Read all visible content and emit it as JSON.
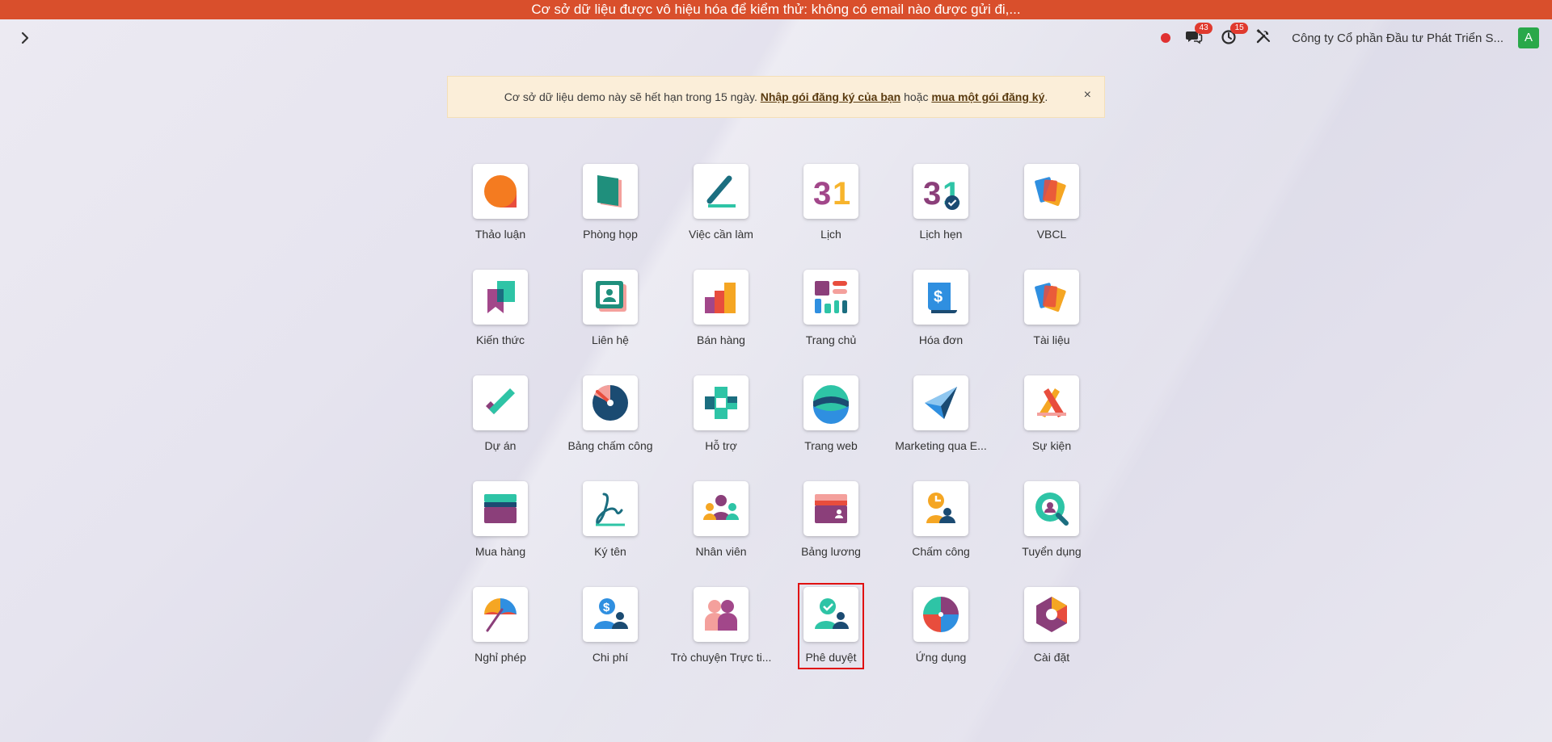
{
  "banner": {
    "text": "Cơ sở dữ liệu được vô hiệu hóa để kiểm thử: không có email nào được gửi đi,..."
  },
  "navbar": {
    "toggle_icon": "chevron-right-icon",
    "recording_color": "#e03131",
    "messages_count": "43",
    "activities_count": "15",
    "company": "Công ty Cổ phần Đầu tư Phát Triển S...",
    "avatar_letter": "A"
  },
  "alert": {
    "text_before": "Cơ sở dữ liệu demo này sẽ hết hạn trong 15 ngày. ",
    "link1": "Nhập gói đăng ký của bạn",
    "text_mid": " hoặc ",
    "link2": "mua một gói đăng ký",
    "text_after": ".",
    "close": "×"
  },
  "apps": [
    {
      "label": "Thảo luận",
      "icon": "discuss-icon"
    },
    {
      "label": "Phòng họp",
      "icon": "meeting-room-icon"
    },
    {
      "label": "Việc cần làm",
      "icon": "todo-icon"
    },
    {
      "label": "Lịch",
      "icon": "calendar-icon"
    },
    {
      "label": "Lịch hẹn",
      "icon": "appointment-icon"
    },
    {
      "label": "VBCL",
      "icon": "vbcl-icon"
    },
    {
      "label": "Kiến thức",
      "icon": "knowledge-icon"
    },
    {
      "label": "Liên hệ",
      "icon": "contacts-icon"
    },
    {
      "label": "Bán hàng",
      "icon": "sales-icon"
    },
    {
      "label": "Trang chủ",
      "icon": "dashboard-icon"
    },
    {
      "label": "Hóa đơn",
      "icon": "invoice-icon"
    },
    {
      "label": "Tài liệu",
      "icon": "documents-icon"
    },
    {
      "label": "Dự án",
      "icon": "project-icon"
    },
    {
      "label": "Bảng chấm công",
      "icon": "timesheet-icon"
    },
    {
      "label": "Hỗ trợ",
      "icon": "helpdesk-icon"
    },
    {
      "label": "Trang web",
      "icon": "website-icon"
    },
    {
      "label": "Marketing qua E...",
      "icon": "email-marketing-icon"
    },
    {
      "label": "Sự kiện",
      "icon": "events-icon"
    },
    {
      "label": "Mua hàng",
      "icon": "purchase-icon"
    },
    {
      "label": "Ký tên",
      "icon": "sign-icon"
    },
    {
      "label": "Nhân viên",
      "icon": "employees-icon"
    },
    {
      "label": "Bảng lương",
      "icon": "payroll-icon"
    },
    {
      "label": "Chấm công",
      "icon": "attendance-icon"
    },
    {
      "label": "Tuyển dụng",
      "icon": "recruitment-icon"
    },
    {
      "label": "Nghỉ phép",
      "icon": "time-off-icon"
    },
    {
      "label": "Chi phí",
      "icon": "expenses-icon"
    },
    {
      "label": "Trò chuyện Trực ti...",
      "icon": "live-chat-icon"
    },
    {
      "label": "Phê duyệt",
      "icon": "approvals-icon"
    },
    {
      "label": "Ứng dụng",
      "icon": "apps-icon"
    },
    {
      "label": "Cài đặt",
      "icon": "settings-icon"
    }
  ]
}
